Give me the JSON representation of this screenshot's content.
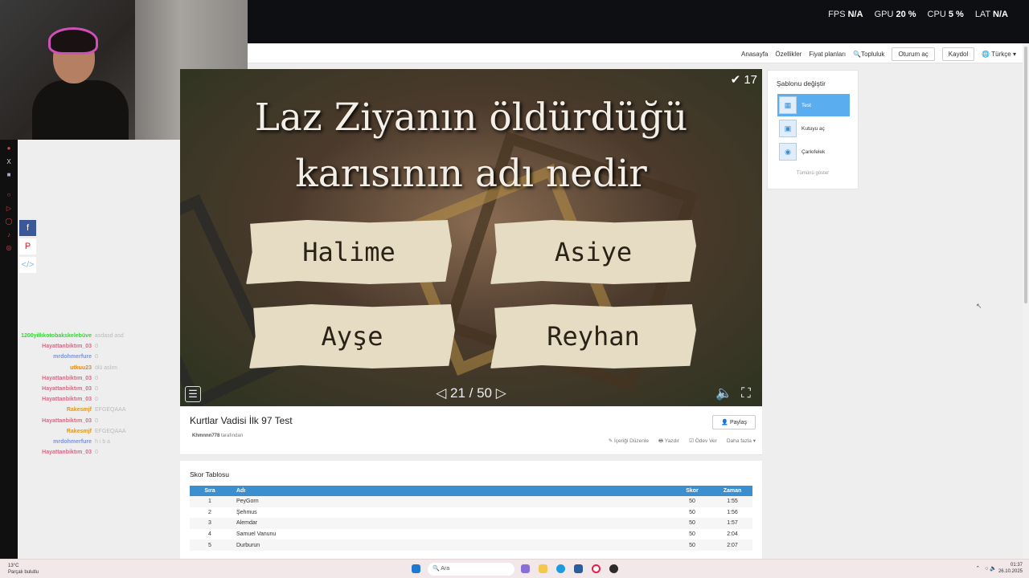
{
  "overlay": {
    "stats": [
      {
        "label": "FPS",
        "value": "N/A"
      },
      {
        "label": "GPU",
        "value": "20 %"
      },
      {
        "label": "CPU",
        "value": "5 %"
      },
      {
        "label": "LAT",
        "value": "N/A"
      }
    ]
  },
  "nav": {
    "home": "Anasayfa",
    "features": "Özellikler",
    "pricing": "Fiyat planları",
    "community": "Topluluk",
    "login": "Oturum aç",
    "signup": "Kaydol",
    "language": "Türkçe"
  },
  "quiz": {
    "question": "Laz Ziyanın öldürdüğü karısının adı nedir",
    "answers": [
      "Halime",
      "Asiye",
      "Ayşe",
      "Reyhan"
    ],
    "score": "17",
    "current": "21",
    "total": "50",
    "page_text": "21 / 50"
  },
  "info": {
    "title": "Kurtlar Vadisi İlk 97 Test",
    "author": "Khmnnn778",
    "author_suffix": "tarafından",
    "share": "Paylaş",
    "actions": [
      "İçeriği Düzenle",
      "Yazdır",
      "Ödev Ver",
      "Daha fazla"
    ]
  },
  "leaderboard": {
    "title": "Skor Tablosu",
    "headers": [
      "Sıra",
      "Adı",
      "Skor",
      "Zaman"
    ],
    "rows": [
      [
        "1",
        "PeyGorn",
        "50",
        "1:55"
      ],
      [
        "2",
        "Şehmus",
        "50",
        "1:56"
      ],
      [
        "3",
        "Alemdar",
        "50",
        "1:57"
      ],
      [
        "4",
        "Samuel Vanunu",
        "50",
        "2:04"
      ],
      [
        "5",
        "Durburun",
        "50",
        "2:07"
      ]
    ]
  },
  "template_panel": {
    "title": "Şablonu değiştir",
    "items": [
      "Test",
      "Kutuyu aç",
      "Çarkıfelek"
    ],
    "more": "Tümünü göster"
  },
  "chat": [
    {
      "name": "1200yillıkotobakskelebüve",
      "msg": "asdasd asd",
      "color": "#3bd43b"
    },
    {
      "name": "Hayattanbiktım_03",
      "msg": "0",
      "color": "#d36b87"
    },
    {
      "name": "mrdohmerfure",
      "msg": "0",
      "color": "#7d93d8"
    },
    {
      "name": "utkuu23",
      "msg": "ölü aslım",
      "color": "#e08a1c"
    },
    {
      "name": "Hayattanbiktım_03",
      "msg": "0",
      "color": "#d36b87"
    },
    {
      "name": "Hayattanbiktım_03",
      "msg": "0",
      "color": "#d36b87"
    },
    {
      "name": "Hayattanbiktım_03",
      "msg": "0",
      "color": "#d36b87"
    },
    {
      "name": "Rakesmjf",
      "msg": "EFGEQAAA",
      "color": "#d9982a"
    },
    {
      "name": "Hayattanbiktım_03",
      "msg": "0",
      "color": "#d36b87"
    },
    {
      "name": "Rakesmjf",
      "msg": "EFGEQAAA",
      "color": "#d9982a"
    },
    {
      "name": "mrdohmerfure",
      "msg": "h i b a",
      "color": "#7d93d8"
    },
    {
      "name": "Hayattanbiktım_03",
      "msg": "0",
      "color": "#d36b87"
    }
  ],
  "taskbar": {
    "weather_temp": "13°C",
    "weather_desc": "Parçalı bulutlu",
    "search": "Ara",
    "time": "01:37",
    "date": "26.10.2025"
  }
}
